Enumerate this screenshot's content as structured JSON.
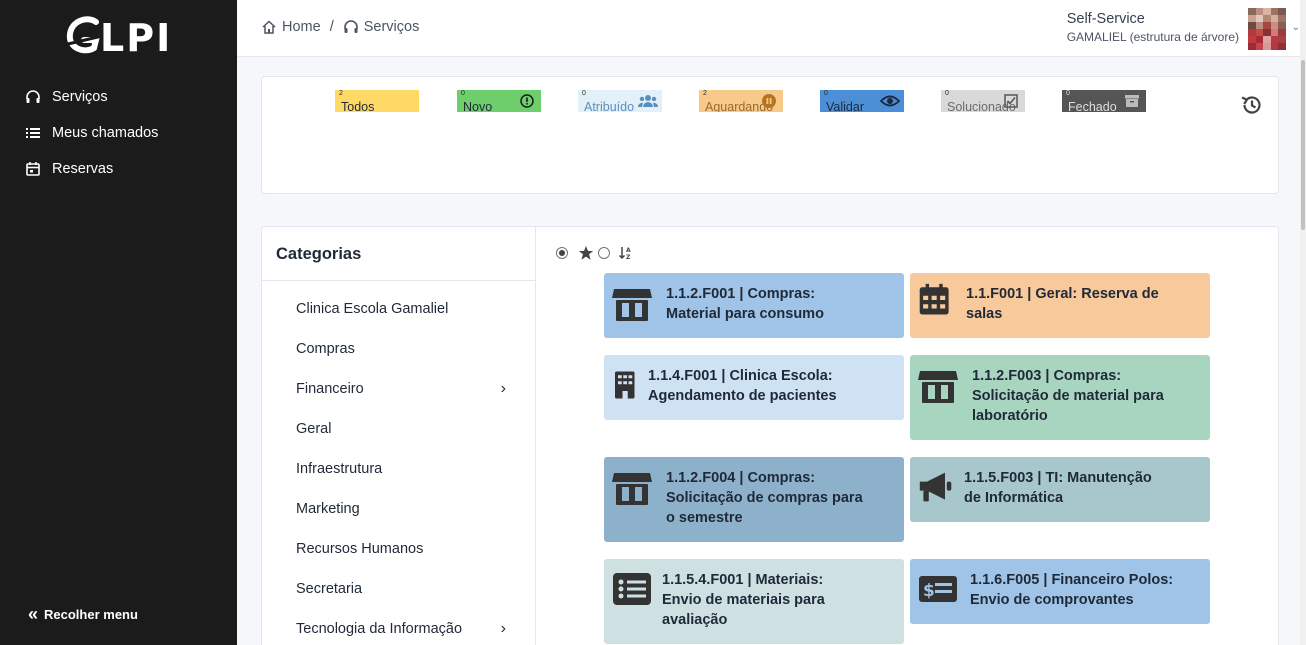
{
  "app": {
    "logo_text": "LPI"
  },
  "sidebar": {
    "items": [
      {
        "label": "Serviços",
        "icon": "headset-icon"
      },
      {
        "label": "Meus chamados",
        "icon": "list-icon"
      },
      {
        "label": "Reservas",
        "icon": "calendar-icon"
      }
    ],
    "collapse_label": "Recolher menu"
  },
  "header": {
    "breadcrumb": [
      {
        "label": "Home"
      },
      {
        "label": "Serviços"
      }
    ],
    "separator": "/",
    "profile_name": "Self-Service",
    "profile_entity": "GAMALIEL (estrutura de árvore)"
  },
  "status_tiles": [
    {
      "label": "Todos",
      "count": "2",
      "color": "#ffd966"
    },
    {
      "label": "Novo",
      "count": "0",
      "color": "#6ece6c"
    },
    {
      "label": "Atribuído",
      "count": "0",
      "color": "#e3f0f7"
    },
    {
      "label": "Aguardando",
      "count": "2",
      "color": "#f7c98b"
    },
    {
      "label": "Validar",
      "count": "0",
      "color": "#4d8fd6"
    },
    {
      "label": "Solucionado",
      "count": "0",
      "color": "#d9d9d9"
    },
    {
      "label": "Fechado",
      "count": "0",
      "color": "#555555"
    }
  ],
  "categories": {
    "title": "Categorias",
    "items": [
      {
        "label": "Clinica Escola Gamaliel",
        "has_children": false
      },
      {
        "label": "Compras",
        "has_children": false
      },
      {
        "label": "Financeiro",
        "has_children": true
      },
      {
        "label": "Geral",
        "has_children": false
      },
      {
        "label": "Infraestrutura",
        "has_children": false
      },
      {
        "label": "Marketing",
        "has_children": false
      },
      {
        "label": "Recursos Humanos",
        "has_children": false
      },
      {
        "label": "Secretaria",
        "has_children": false
      },
      {
        "label": "Tecnologia da Informação",
        "has_children": true
      }
    ]
  },
  "forms": [
    {
      "line1": "1.1.2.F001 | Compras:",
      "line2": "Material para consumo",
      "line3": "",
      "icon": "store-icon",
      "color": "#9fc4e7"
    },
    {
      "line1": "1.1.F001 | Geral: Reserva de",
      "line2": "salas",
      "line3": "",
      "icon": "calendar-icon",
      "color": "#f8c99b"
    },
    {
      "line1": "1.1.4.F001 | Clinica Escola:",
      "line2": "Agendamento de pacientes",
      "line3": "",
      "icon": "building-icon",
      "color": "#cfe2f3"
    },
    {
      "line1": "1.1.2.F003 | Compras:",
      "line2": "Solicitação de material para",
      "line3": "laboratório",
      "icon": "store-icon",
      "color": "#a8d5c0"
    },
    {
      "line1": "1.1.2.F004 | Compras:",
      "line2": "Solicitação de compras para",
      "line3": "o semestre",
      "icon": "store-icon",
      "color": "#8eb1cb"
    },
    {
      "line1": "1.1.5.F003 | TI: Manutenção",
      "line2": "de Informática",
      "line3": "",
      "icon": "megaphone-icon",
      "color": "#a7c7cd"
    },
    {
      "line1": "1.1.5.4.F001 | Materiais:",
      "line2": "Envio de materiais para",
      "line3": "avaliação",
      "icon": "list-alt-icon",
      "color": "#cfe0e3"
    },
    {
      "line1": "1.1.6.F005 | Financeiro Polos:",
      "line2": "Envio de comprovantes",
      "line3": "",
      "icon": "money-bill-icon",
      "color": "#9fc4e7"
    }
  ]
}
